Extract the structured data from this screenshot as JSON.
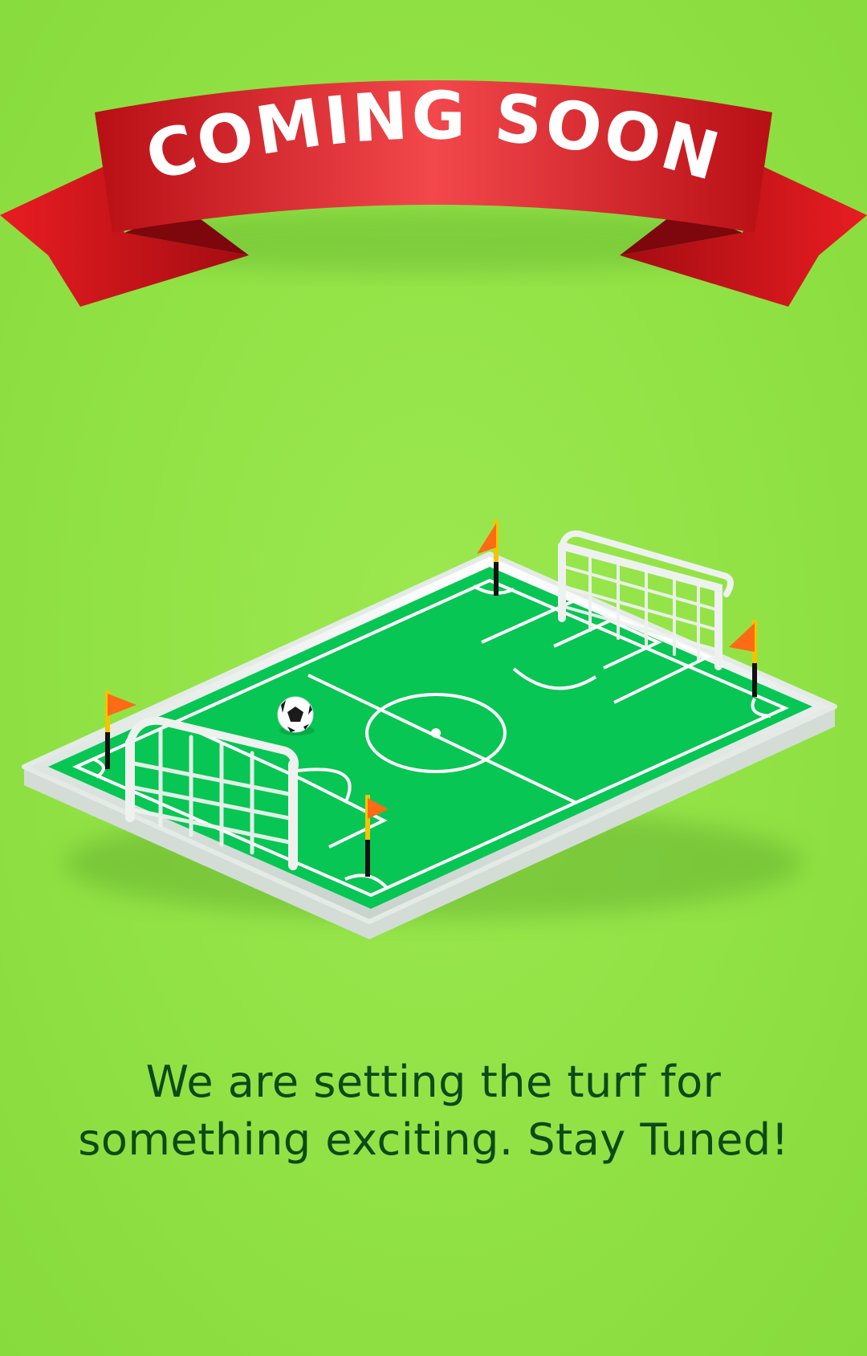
{
  "banner": {
    "title": "COMING SOON",
    "ribbon_color": "#d4161c",
    "ribbon_highlight": "#f2484c",
    "text_color": "#ffffff"
  },
  "illustration": {
    "name": "soccer-field-3d",
    "field_color": "#07c654",
    "base_color": "#e8eee9",
    "line_color": "#ffffff",
    "flag_color": "#ff6a14",
    "pole_color": "#f5c400",
    "items": [
      "soccer-field",
      "goal-left",
      "goal-right",
      "soccer-ball",
      "corner-flags"
    ]
  },
  "message": {
    "line1": "We are setting the turf for",
    "line2": "something exciting. Stay Tuned!",
    "color": "#0c4a17"
  }
}
